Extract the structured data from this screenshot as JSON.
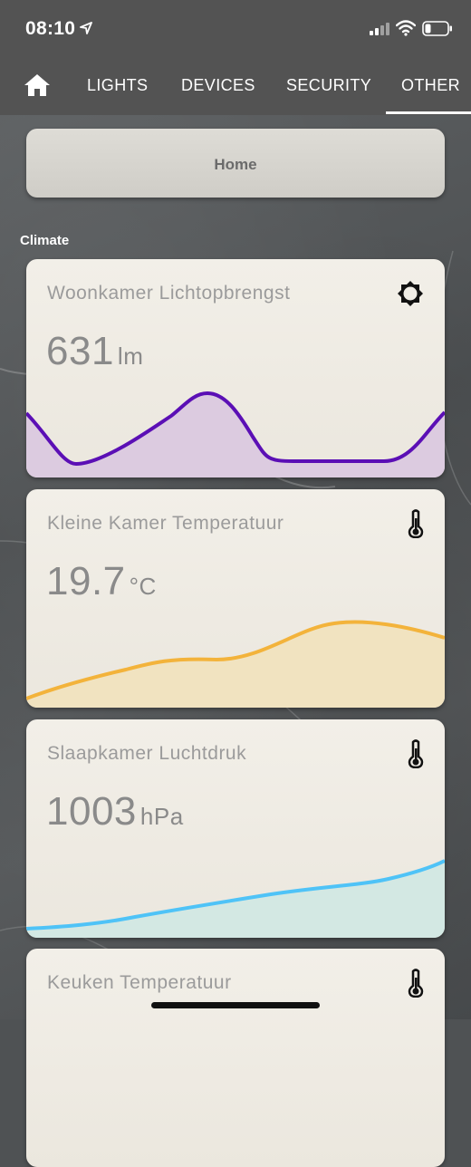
{
  "status_bar": {
    "time": "08:10",
    "icons": [
      "location-arrow-icon",
      "cellular-signal-icon",
      "wifi-icon",
      "battery-icon"
    ]
  },
  "tabs": [
    {
      "icon": "home-icon",
      "label": ""
    },
    {
      "label": "LIGHTS"
    },
    {
      "label": "DEVICES"
    },
    {
      "label": "SECURITY"
    },
    {
      "label": "OTHER",
      "active": true
    }
  ],
  "home_button": {
    "label": "Home",
    "icon": "home-icon"
  },
  "section": {
    "title": "Climate"
  },
  "cards": [
    {
      "name": "Woonkamer Lichtopbrengst",
      "value": "631",
      "unit": "lm",
      "icon": "brightness-icon",
      "color": "#5b0fb5",
      "fill": "#dccbe0"
    },
    {
      "name": "Kleine Kamer Temperatuur",
      "value": "19.7",
      "unit": "°C",
      "icon": "thermometer-icon",
      "color": "#f3b33b",
      "fill": "#f1e3c0"
    },
    {
      "name": "Slaapkamer Luchtdruk",
      "value": "1003",
      "unit": "hPa",
      "icon": "thermometer-icon",
      "color": "#4fc3f7",
      "fill": "#d3e8e3"
    },
    {
      "name": "Keuken Temperatuur",
      "value": "",
      "unit": "",
      "icon": "thermometer-icon"
    }
  ]
}
